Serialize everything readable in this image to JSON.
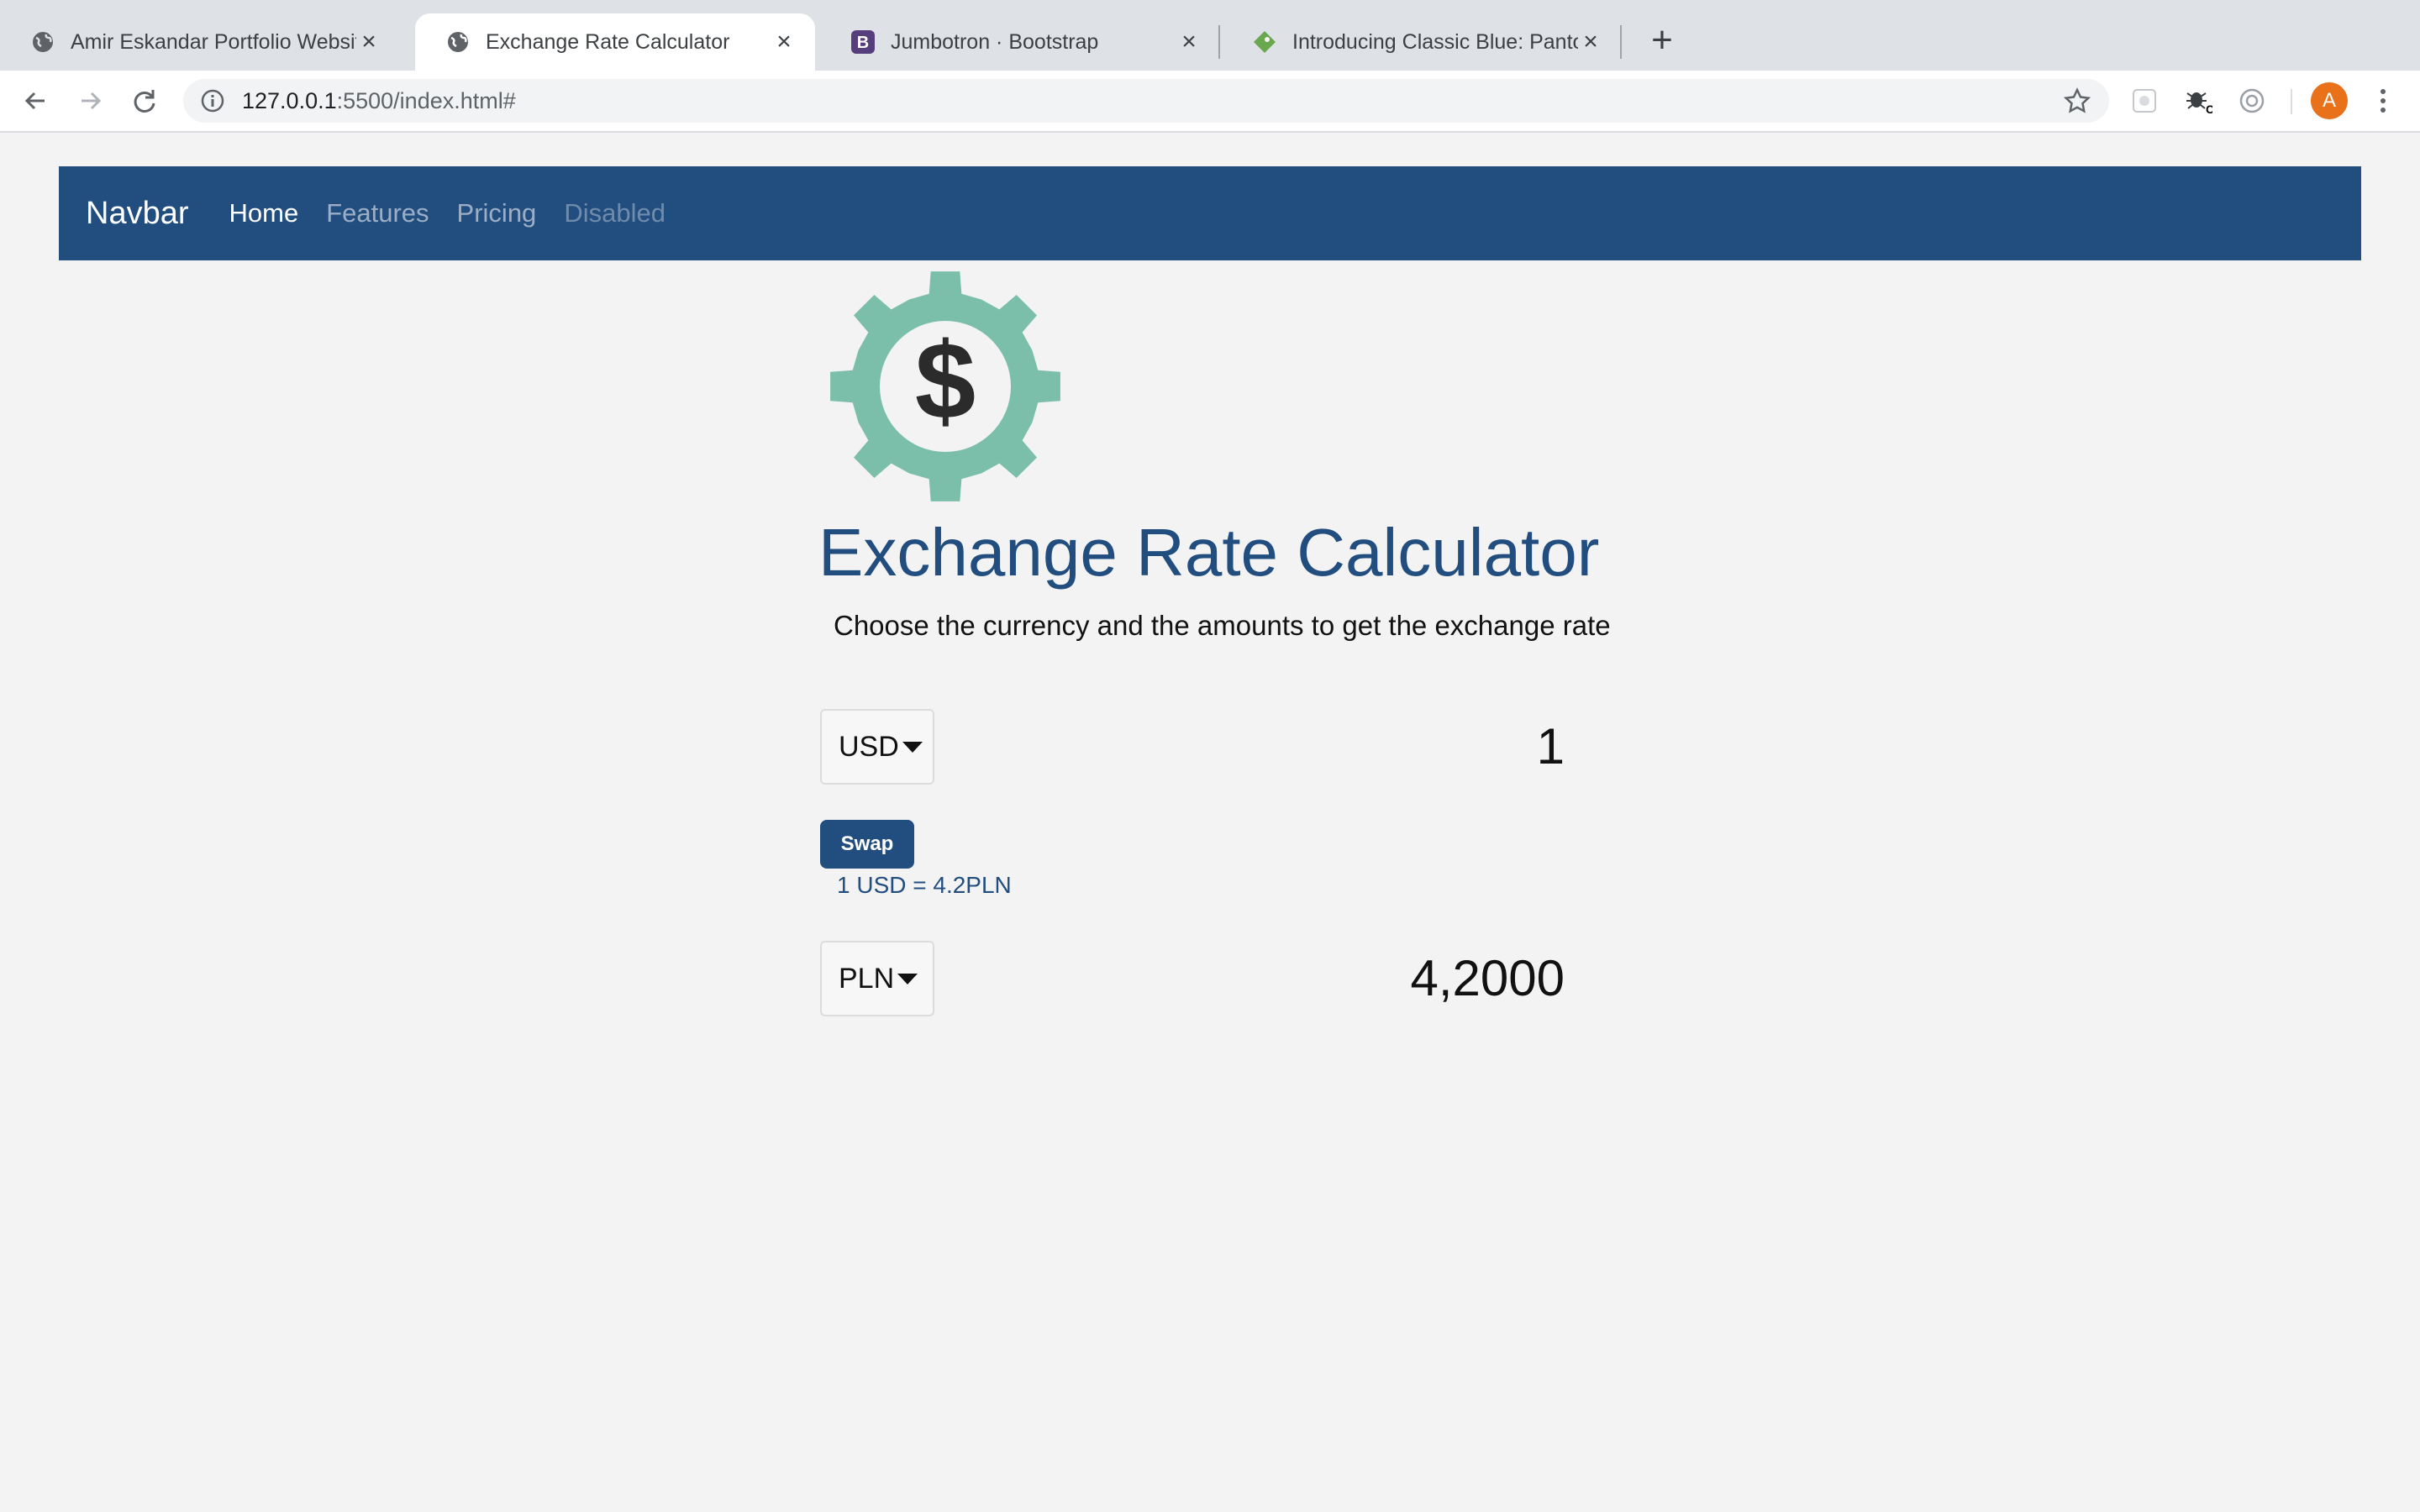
{
  "browser": {
    "tabs": [
      {
        "title": "Amir Eskandar Portfolio Website",
        "favicon": "globe-icon",
        "active": false
      },
      {
        "title": "Exchange Rate Calculator",
        "favicon": "globe-icon",
        "active": true
      },
      {
        "title": "Jumbotron · Bootstrap",
        "favicon": "bootstrap-icon",
        "active": false
      },
      {
        "title": "Introducing Classic Blue: Pantone",
        "favicon": "tag-icon",
        "active": false
      }
    ],
    "url_host": "127.0.0.1",
    "url_path": ":5500/index.html#",
    "profile_initial": "A",
    "colors": {
      "tabbar": "#dee1e6",
      "avatar": "#e8711a"
    }
  },
  "navbar": {
    "brand": "Navbar",
    "links": [
      {
        "label": "Home",
        "state": "active"
      },
      {
        "label": "Features",
        "state": "normal"
      },
      {
        "label": "Pricing",
        "state": "normal"
      },
      {
        "label": "Disabled",
        "state": "disabled"
      }
    ],
    "color": "#224d7f"
  },
  "main": {
    "logo_icon": "dollar-gear-icon",
    "title": "Exchange Rate Calculator",
    "subtitle": "Choose the currency and the amounts to get the exchange rate",
    "from": {
      "currency": "USD",
      "amount": "1"
    },
    "swap_label": "Swap",
    "rate_text": "1 USD = 4.2PLN",
    "to": {
      "currency": "PLN",
      "amount": "4,2000"
    },
    "colors": {
      "primary": "#224d7f",
      "gear": "#7bbfaa"
    }
  }
}
